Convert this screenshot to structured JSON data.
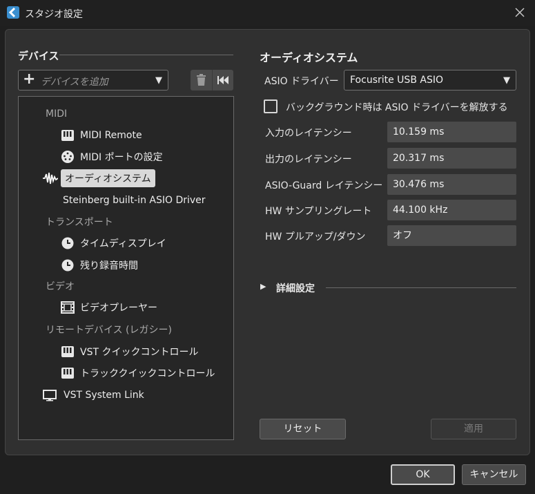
{
  "window": {
    "title": "スタジオ設定"
  },
  "devices": {
    "section_title": "デバイス",
    "add_device_placeholder": "デバイスを追加",
    "tree": [
      {
        "type": "category",
        "label": "MIDI"
      },
      {
        "type": "leaf",
        "label": "MIDI Remote",
        "icon": "midi-remote-icon"
      },
      {
        "type": "leaf",
        "label": "MIDI ポートの設定",
        "icon": "midi-port-icon"
      },
      {
        "type": "selected",
        "label": "オーディオシステム",
        "icon": "audio-wave-icon"
      },
      {
        "type": "leaf",
        "label": "Steinberg built-in ASIO Driver"
      },
      {
        "type": "category",
        "label": "トランスポート"
      },
      {
        "type": "leaf",
        "label": "タイムディスプレイ",
        "icon": "clock-icon"
      },
      {
        "type": "leaf",
        "label": "残り録音時間",
        "icon": "clock-icon"
      },
      {
        "type": "category",
        "label": "ビデオ"
      },
      {
        "type": "leaf",
        "label": "ビデオプレーヤー",
        "icon": "film-icon"
      },
      {
        "type": "category",
        "label": "リモートデバイス (レガシー)"
      },
      {
        "type": "leaf",
        "label": "VST クイックコントロール",
        "icon": "midi-remote-icon"
      },
      {
        "type": "leaf",
        "label": "トラッククイックコントロール",
        "icon": "midi-remote-icon"
      },
      {
        "type": "leaf",
        "label": "VST System Link",
        "icon": "monitor-icon"
      }
    ]
  },
  "audio_system": {
    "section_title": "オーディオシステム",
    "asio_driver_label": "ASIO ドライバー",
    "asio_driver_value": "Focusrite USB ASIO",
    "release_checkbox_label": "バックグラウンド時は ASIO ドライバーを解放する",
    "release_checkbox_checked": false,
    "fields": [
      {
        "label": "入力のレイテンシー",
        "value": "10.159 ms"
      },
      {
        "label": "出力のレイテンシー",
        "value": "20.317 ms"
      },
      {
        "label": "ASIO-Guard レイテンシー",
        "value": "30.476 ms"
      },
      {
        "label": "HW サンプリングレート",
        "value": "44.100 kHz"
      },
      {
        "label": "HW プルアップ/ダウン",
        "value": "オフ"
      }
    ],
    "advanced_label": "詳細設定",
    "reset_label": "リセット",
    "apply_label": "適用"
  },
  "footer": {
    "ok_label": "OK",
    "cancel_label": "キャンセル"
  },
  "colors": {
    "accent": "#3a8fd0",
    "background": "#303030",
    "selected": "#d9d9d9"
  }
}
